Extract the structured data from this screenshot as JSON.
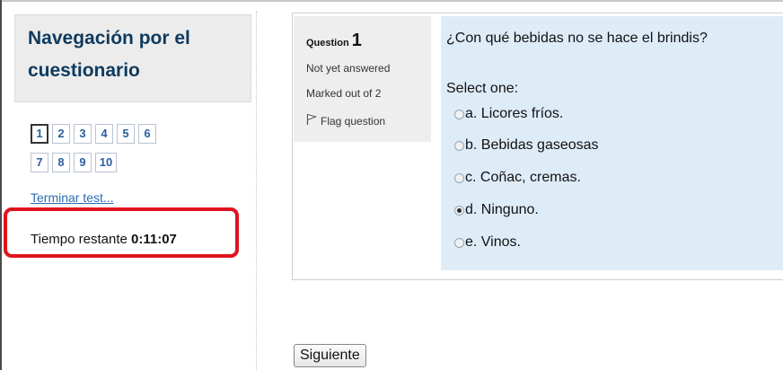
{
  "nav": {
    "title_line1": "Navegación por el",
    "title_line2": "cuestionario",
    "questions_row1": [
      "1",
      "2",
      "3",
      "4",
      "5",
      "6"
    ],
    "questions_row2": [
      "7",
      "8",
      "9",
      "10"
    ],
    "current_question": "1",
    "finish_link": "Terminar test...",
    "timer_label": "Tiempo restante",
    "timer_value": "0:11:07",
    "highlight_color": "#e0141e"
  },
  "question": {
    "label": "Question",
    "number": "1",
    "state": "Not yet answered",
    "marked_out_of": "Marked out of 2",
    "flag_label": "Flag question",
    "flag_icon": "flag-icon",
    "text": "¿Con qué bebidas no se hace el brindis?",
    "prompt": "Select one:",
    "options": [
      {
        "text": "a. Licores fríos.",
        "checked": false
      },
      {
        "text": "b. Bebidas gaseosas",
        "checked": false
      },
      {
        "text": "c. Coñac, cremas.",
        "checked": false
      },
      {
        "text": "d. Ninguno.",
        "checked": true
      },
      {
        "text": "e. Vinos.",
        "checked": false
      }
    ]
  },
  "actions": {
    "next_label": "Siguiente"
  }
}
